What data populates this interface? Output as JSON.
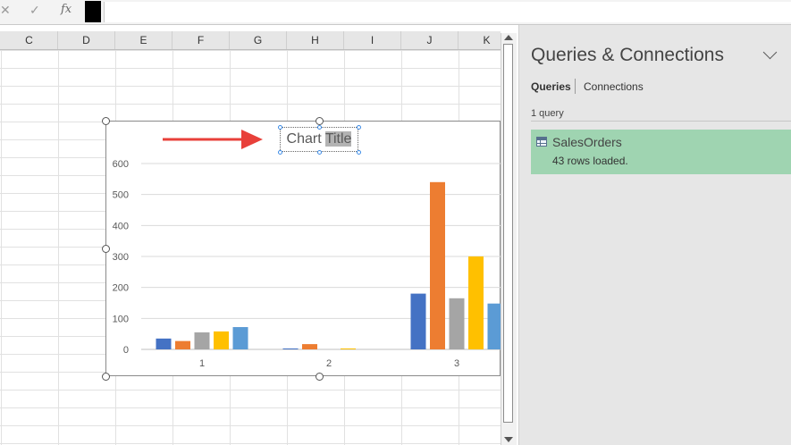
{
  "formula_bar": {
    "cancel_icon": "✕",
    "enter_icon": "✓",
    "fx_label": "fx",
    "value": ""
  },
  "columns": [
    "C",
    "D",
    "E",
    "F",
    "G",
    "H",
    "I",
    "J",
    "K"
  ],
  "chart": {
    "title_part1": "Chart ",
    "title_part2": "Title",
    "annotation_arrow_color": "#e8403a"
  },
  "chart_data": {
    "type": "bar",
    "categories": [
      "1",
      "2",
      "3"
    ],
    "series": [
      {
        "color": "#4472c4",
        "values": [
          35,
          3,
          180
        ]
      },
      {
        "color": "#ed7d31",
        "values": [
          27,
          17,
          540
        ]
      },
      {
        "color": "#a5a5a5",
        "values": [
          55,
          0,
          165
        ]
      },
      {
        "color": "#ffc000",
        "values": [
          58,
          3,
          300
        ]
      },
      {
        "color": "#5b9bd5",
        "values": [
          72,
          0,
          148
        ]
      }
    ],
    "yticks": [
      "0",
      "100",
      "200",
      "300",
      "400",
      "500",
      "600"
    ],
    "ylim": [
      0,
      600
    ],
    "grid": true
  },
  "queries_pane": {
    "title": "Queries & Connections",
    "tab_queries": "Queries",
    "tab_connections": "Connections",
    "query_count": "1 query",
    "items": [
      {
        "name": "SalesOrders",
        "status": "43 rows loaded.",
        "icon": "table-icon"
      }
    ],
    "selected_color": "#9fd4b1"
  }
}
